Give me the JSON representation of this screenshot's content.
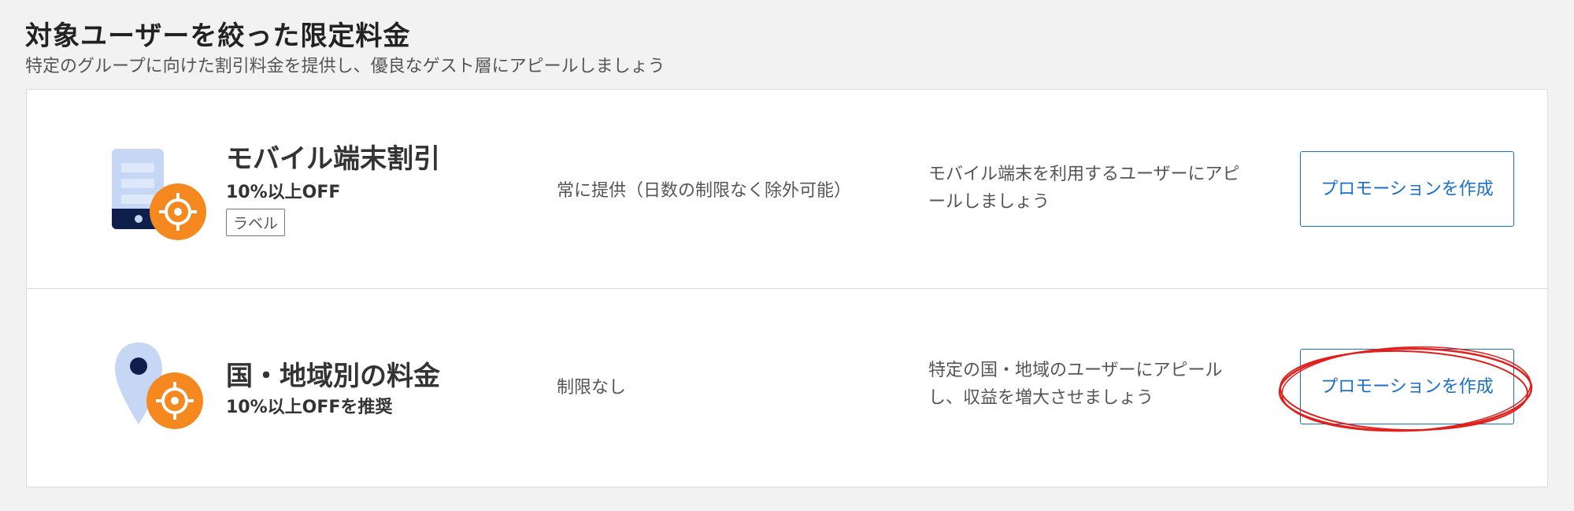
{
  "header": {
    "title": "対象ユーザーを絞った限定料金",
    "subtitle": "特定のグループに向けた割引料金を提供し、優良なゲスト層にアピールしましょう"
  },
  "rows": [
    {
      "icon": "mobile-target-icon",
      "title": "モバイル端末割引",
      "discount": "10%以上OFF",
      "label": "ラベル",
      "period": "常に提供（日数の制限なく除外可能）",
      "description": "モバイル端末を利用するユーザーにアピールしましょう",
      "button": "プロモーションを作成"
    },
    {
      "icon": "location-target-icon",
      "title": "国・地域別の料金",
      "discount": "10%以上OFFを推奨",
      "period": "制限なし",
      "description": "特定の国・地域のユーザーにアピールし、収益を増大させましょう",
      "button": "プロモーションを作成"
    }
  ],
  "colors": {
    "accent_blue": "#1a6fc9",
    "icon_orange": "#f5891f",
    "icon_light_blue": "#c5d7f5",
    "icon_navy": "#0f1f4b",
    "annotation_red": "#e0201b"
  }
}
